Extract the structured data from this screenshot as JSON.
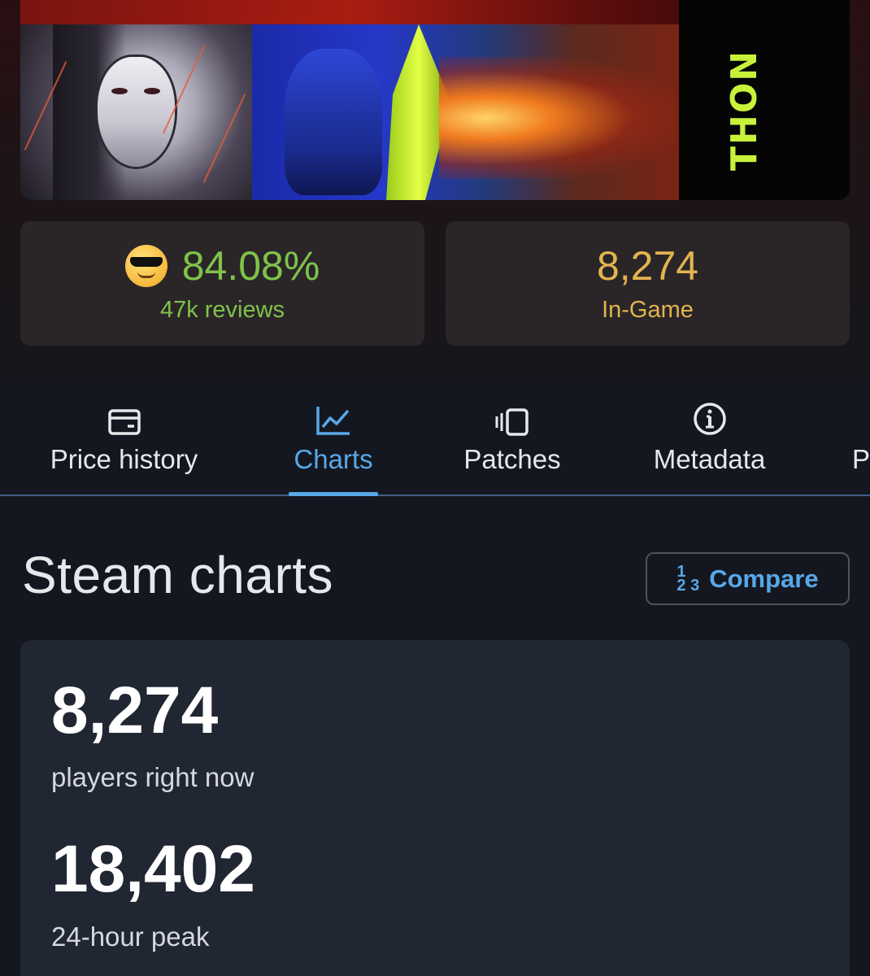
{
  "banner": {
    "title_fragment": "THON"
  },
  "stats": {
    "rating": {
      "emoji": "sunglasses-face",
      "percent": "84.08%",
      "reviews": "47k reviews",
      "color": "#7ec34a"
    },
    "players": {
      "value": "8,274",
      "label": "In-Game",
      "color": "#e3b34f"
    }
  },
  "tabs": [
    {
      "label": "Price history",
      "icon": "credit-card-icon",
      "active": false
    },
    {
      "label": "Charts",
      "icon": "line-chart-icon",
      "active": true
    },
    {
      "label": "Patches",
      "icon": "patches-icon",
      "active": false
    },
    {
      "label": "Metadata",
      "icon": "info-icon",
      "active": false
    },
    {
      "label": "P",
      "icon": "",
      "active": false
    }
  ],
  "section": {
    "title": "Steam charts",
    "compare_label": "Compare",
    "compare_icon_top": "1",
    "compare_icon_mid": "2 3"
  },
  "charts_card": {
    "current": {
      "value": "8,274",
      "label": "players right now"
    },
    "peak": {
      "value": "18,402",
      "label": "24-hour peak"
    }
  },
  "colors": {
    "accent": "#57a8e8",
    "background": "#14171f",
    "card": "#202632"
  }
}
